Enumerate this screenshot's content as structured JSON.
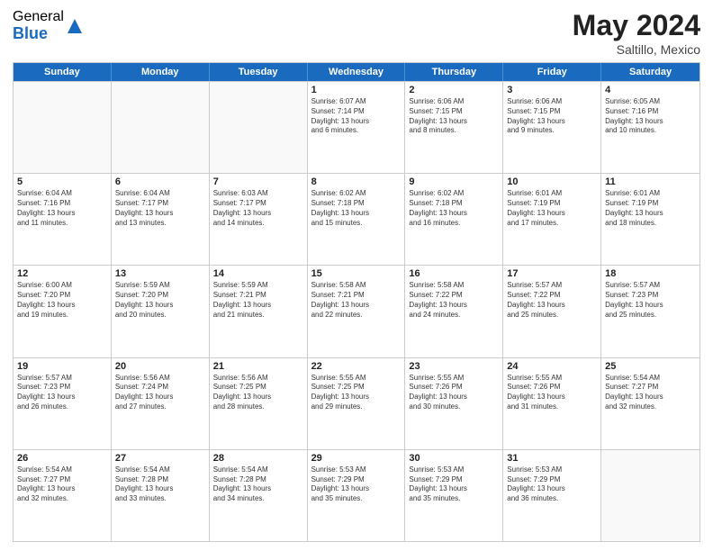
{
  "logo": {
    "general": "General",
    "blue": "Blue"
  },
  "title": "May 2024",
  "subtitle": "Saltillo, Mexico",
  "days": [
    "Sunday",
    "Monday",
    "Tuesday",
    "Wednesday",
    "Thursday",
    "Friday",
    "Saturday"
  ],
  "weeks": [
    [
      {
        "num": "",
        "lines": []
      },
      {
        "num": "",
        "lines": []
      },
      {
        "num": "",
        "lines": []
      },
      {
        "num": "1",
        "lines": [
          "Sunrise: 6:07 AM",
          "Sunset: 7:14 PM",
          "Daylight: 13 hours",
          "and 6 minutes."
        ]
      },
      {
        "num": "2",
        "lines": [
          "Sunrise: 6:06 AM",
          "Sunset: 7:15 PM",
          "Daylight: 13 hours",
          "and 8 minutes."
        ]
      },
      {
        "num": "3",
        "lines": [
          "Sunrise: 6:06 AM",
          "Sunset: 7:15 PM",
          "Daylight: 13 hours",
          "and 9 minutes."
        ]
      },
      {
        "num": "4",
        "lines": [
          "Sunrise: 6:05 AM",
          "Sunset: 7:16 PM",
          "Daylight: 13 hours",
          "and 10 minutes."
        ]
      }
    ],
    [
      {
        "num": "5",
        "lines": [
          "Sunrise: 6:04 AM",
          "Sunset: 7:16 PM",
          "Daylight: 13 hours",
          "and 11 minutes."
        ]
      },
      {
        "num": "6",
        "lines": [
          "Sunrise: 6:04 AM",
          "Sunset: 7:17 PM",
          "Daylight: 13 hours",
          "and 13 minutes."
        ]
      },
      {
        "num": "7",
        "lines": [
          "Sunrise: 6:03 AM",
          "Sunset: 7:17 PM",
          "Daylight: 13 hours",
          "and 14 minutes."
        ]
      },
      {
        "num": "8",
        "lines": [
          "Sunrise: 6:02 AM",
          "Sunset: 7:18 PM",
          "Daylight: 13 hours",
          "and 15 minutes."
        ]
      },
      {
        "num": "9",
        "lines": [
          "Sunrise: 6:02 AM",
          "Sunset: 7:18 PM",
          "Daylight: 13 hours",
          "and 16 minutes."
        ]
      },
      {
        "num": "10",
        "lines": [
          "Sunrise: 6:01 AM",
          "Sunset: 7:19 PM",
          "Daylight: 13 hours",
          "and 17 minutes."
        ]
      },
      {
        "num": "11",
        "lines": [
          "Sunrise: 6:01 AM",
          "Sunset: 7:19 PM",
          "Daylight: 13 hours",
          "and 18 minutes."
        ]
      }
    ],
    [
      {
        "num": "12",
        "lines": [
          "Sunrise: 6:00 AM",
          "Sunset: 7:20 PM",
          "Daylight: 13 hours",
          "and 19 minutes."
        ]
      },
      {
        "num": "13",
        "lines": [
          "Sunrise: 5:59 AM",
          "Sunset: 7:20 PM",
          "Daylight: 13 hours",
          "and 20 minutes."
        ]
      },
      {
        "num": "14",
        "lines": [
          "Sunrise: 5:59 AM",
          "Sunset: 7:21 PM",
          "Daylight: 13 hours",
          "and 21 minutes."
        ]
      },
      {
        "num": "15",
        "lines": [
          "Sunrise: 5:58 AM",
          "Sunset: 7:21 PM",
          "Daylight: 13 hours",
          "and 22 minutes."
        ]
      },
      {
        "num": "16",
        "lines": [
          "Sunrise: 5:58 AM",
          "Sunset: 7:22 PM",
          "Daylight: 13 hours",
          "and 24 minutes."
        ]
      },
      {
        "num": "17",
        "lines": [
          "Sunrise: 5:57 AM",
          "Sunset: 7:22 PM",
          "Daylight: 13 hours",
          "and 25 minutes."
        ]
      },
      {
        "num": "18",
        "lines": [
          "Sunrise: 5:57 AM",
          "Sunset: 7:23 PM",
          "Daylight: 13 hours",
          "and 25 minutes."
        ]
      }
    ],
    [
      {
        "num": "19",
        "lines": [
          "Sunrise: 5:57 AM",
          "Sunset: 7:23 PM",
          "Daylight: 13 hours",
          "and 26 minutes."
        ]
      },
      {
        "num": "20",
        "lines": [
          "Sunrise: 5:56 AM",
          "Sunset: 7:24 PM",
          "Daylight: 13 hours",
          "and 27 minutes."
        ]
      },
      {
        "num": "21",
        "lines": [
          "Sunrise: 5:56 AM",
          "Sunset: 7:25 PM",
          "Daylight: 13 hours",
          "and 28 minutes."
        ]
      },
      {
        "num": "22",
        "lines": [
          "Sunrise: 5:55 AM",
          "Sunset: 7:25 PM",
          "Daylight: 13 hours",
          "and 29 minutes."
        ]
      },
      {
        "num": "23",
        "lines": [
          "Sunrise: 5:55 AM",
          "Sunset: 7:26 PM",
          "Daylight: 13 hours",
          "and 30 minutes."
        ]
      },
      {
        "num": "24",
        "lines": [
          "Sunrise: 5:55 AM",
          "Sunset: 7:26 PM",
          "Daylight: 13 hours",
          "and 31 minutes."
        ]
      },
      {
        "num": "25",
        "lines": [
          "Sunrise: 5:54 AM",
          "Sunset: 7:27 PM",
          "Daylight: 13 hours",
          "and 32 minutes."
        ]
      }
    ],
    [
      {
        "num": "26",
        "lines": [
          "Sunrise: 5:54 AM",
          "Sunset: 7:27 PM",
          "Daylight: 13 hours",
          "and 32 minutes."
        ]
      },
      {
        "num": "27",
        "lines": [
          "Sunrise: 5:54 AM",
          "Sunset: 7:28 PM",
          "Daylight: 13 hours",
          "and 33 minutes."
        ]
      },
      {
        "num": "28",
        "lines": [
          "Sunrise: 5:54 AM",
          "Sunset: 7:28 PM",
          "Daylight: 13 hours",
          "and 34 minutes."
        ]
      },
      {
        "num": "29",
        "lines": [
          "Sunrise: 5:53 AM",
          "Sunset: 7:29 PM",
          "Daylight: 13 hours",
          "and 35 minutes."
        ]
      },
      {
        "num": "30",
        "lines": [
          "Sunrise: 5:53 AM",
          "Sunset: 7:29 PM",
          "Daylight: 13 hours",
          "and 35 minutes."
        ]
      },
      {
        "num": "31",
        "lines": [
          "Sunrise: 5:53 AM",
          "Sunset: 7:29 PM",
          "Daylight: 13 hours",
          "and 36 minutes."
        ]
      },
      {
        "num": "",
        "lines": []
      }
    ]
  ]
}
